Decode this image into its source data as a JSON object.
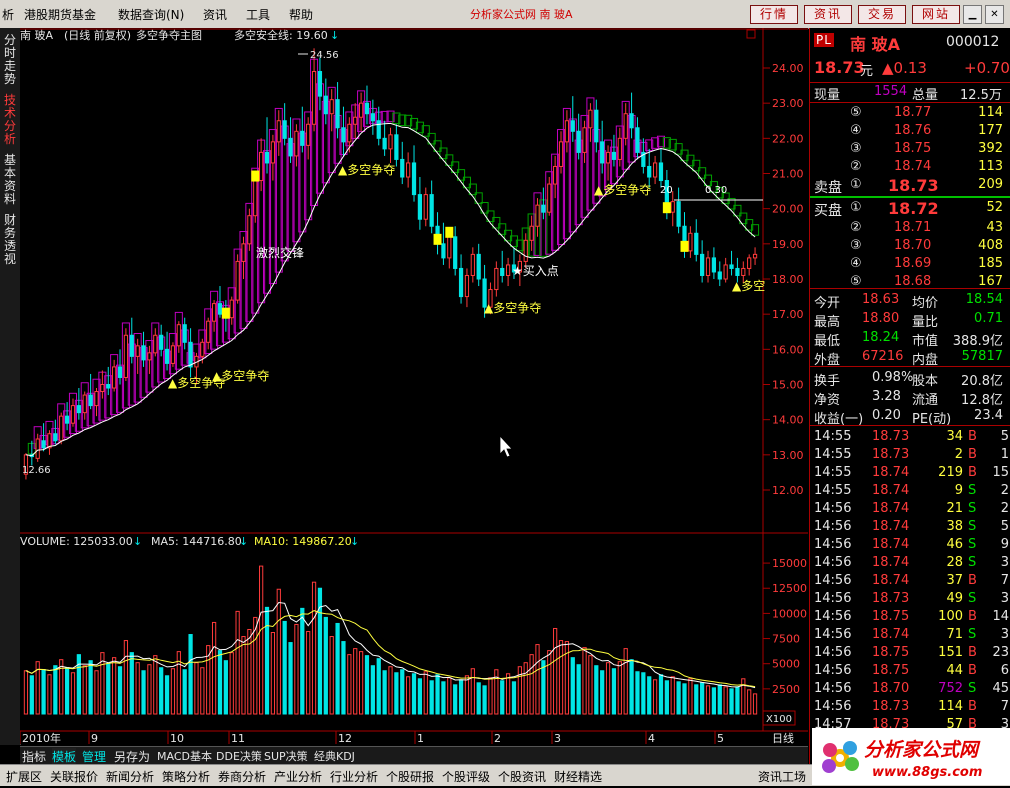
{
  "menu": {
    "items": [
      "析",
      "港股期货基金",
      "数据查询(N)",
      "资讯",
      "工具",
      "帮助"
    ],
    "center_title": "分析家公式网  南  玻A",
    "buttons": [
      "行情",
      "资讯",
      "交易",
      "网站"
    ]
  },
  "vtabs": [
    "分时走势",
    "技术分析",
    "基本资料",
    "财务透视"
  ],
  "chart": {
    "header_name": "南  玻A",
    "header_mode": "(日线 前复权)",
    "header_formula": "多空争夺主图",
    "safety_line_label": "多空安全线: 19.60",
    "max_label": "24.56",
    "min_label": "12.66",
    "y_ticks": [
      "24.00",
      "23.00",
      "22.00",
      "21.00",
      "20.00",
      "19.00",
      "18.00",
      "17.00",
      "16.00",
      "15.00",
      "14.00",
      "13.00",
      "12.00"
    ],
    "annotations": {
      "a1": "▲多空争夺",
      "a2": "▲多空争夺",
      "a3": "▲多空争夺",
      "a4": "▲多空争夺",
      "a5": "▲多空争夺",
      "a6": "▲多空",
      "buy": "★买入点",
      "cross": "激烈交锋",
      "v030": "0.30",
      "v020": "20"
    },
    "volume_label": "VOLUME: 125033.00",
    "ma5_label": "MA5: 144716.80",
    "ma10_label": "MA10: 149867.20",
    "vol_ticks": [
      "15000",
      "12500",
      "10000",
      "7500",
      "5000",
      "2500"
    ],
    "vol_unit": "X100",
    "x_axis": [
      "2010年",
      "9",
      "10",
      "11",
      "12",
      "1",
      "2",
      "3",
      "4",
      "5"
    ],
    "period": "日线",
    "colors": {
      "up": "#ff3b3b",
      "down": "#00e5e5",
      "ma": "#ffffff",
      "band_up": "#c000c0",
      "band_down": "#00a000",
      "marker": "#ffff00"
    },
    "candles": [
      [
        12.45,
        13.05,
        12.3,
        13.0
      ],
      [
        13.0,
        13.4,
        12.7,
        12.95
      ],
      [
        12.9,
        13.6,
        12.8,
        13.45
      ],
      [
        13.4,
        13.9,
        13.1,
        13.2
      ],
      [
        13.2,
        13.7,
        13.0,
        13.6
      ],
      [
        13.6,
        14.0,
        13.3,
        13.4
      ],
      [
        13.4,
        14.2,
        13.3,
        14.1
      ],
      [
        14.1,
        14.5,
        13.7,
        13.9
      ],
      [
        13.9,
        14.6,
        13.8,
        14.4
      ],
      [
        14.4,
        14.9,
        14.0,
        14.2
      ],
      [
        14.2,
        14.8,
        14.0,
        14.7
      ],
      [
        14.7,
        15.3,
        14.3,
        14.4
      ],
      [
        14.4,
        14.9,
        14.1,
        14.8
      ],
      [
        14.8,
        15.4,
        14.6,
        15.0
      ],
      [
        15.0,
        15.5,
        14.7,
        14.9
      ],
      [
        14.9,
        15.7,
        14.8,
        15.5
      ],
      [
        15.5,
        16.0,
        15.0,
        15.2
      ],
      [
        15.2,
        16.6,
        15.1,
        16.4
      ],
      [
        16.4,
        16.9,
        15.6,
        15.8
      ],
      [
        15.8,
        16.3,
        15.3,
        16.1
      ],
      [
        16.1,
        16.5,
        15.5,
        15.7
      ],
      [
        15.7,
        16.1,
        15.3,
        15.9
      ],
      [
        15.9,
        16.6,
        15.8,
        16.4
      ],
      [
        16.4,
        16.7,
        15.8,
        16.0
      ],
      [
        16.0,
        16.5,
        15.4,
        15.6
      ],
      [
        15.6,
        16.2,
        15.5,
        16.1
      ],
      [
        16.1,
        16.8,
        15.9,
        16.7
      ],
      [
        16.7,
        16.9,
        16.0,
        16.2
      ],
      [
        16.2,
        16.6,
        15.2,
        15.5
      ],
      [
        15.5,
        15.9,
        15.0,
        15.8
      ],
      [
        15.8,
        16.3,
        15.6,
        16.2
      ],
      [
        16.2,
        16.9,
        16.0,
        16.8
      ],
      [
        16.8,
        17.4,
        16.5,
        17.3
      ],
      [
        17.3,
        17.8,
        16.9,
        17.0
      ],
      [
        17.0,
        17.4,
        16.5,
        16.9
      ],
      [
        16.9,
        17.5,
        16.7,
        17.4
      ],
      [
        17.4,
        18.7,
        17.3,
        18.5
      ],
      [
        18.5,
        19.2,
        18.0,
        19.0
      ],
      [
        19.0,
        20.0,
        18.8,
        19.8
      ],
      [
        19.8,
        21.0,
        19.6,
        20.8
      ],
      [
        20.8,
        22.0,
        20.5,
        21.6
      ],
      [
        21.6,
        22.6,
        21.0,
        21.3
      ],
      [
        21.3,
        22.1,
        20.8,
        21.9
      ],
      [
        21.9,
        22.8,
        21.5,
        22.5
      ],
      [
        22.5,
        23.0,
        21.8,
        22.0
      ],
      [
        22.0,
        22.6,
        21.3,
        21.5
      ],
      [
        21.5,
        22.4,
        21.2,
        22.2
      ],
      [
        22.2,
        22.9,
        21.6,
        21.8
      ],
      [
        21.8,
        22.6,
        21.4,
        22.4
      ],
      [
        22.4,
        24.56,
        22.2,
        23.9
      ],
      [
        23.9,
        24.3,
        22.8,
        23.2
      ],
      [
        23.2,
        23.7,
        22.4,
        22.7
      ],
      [
        22.7,
        23.4,
        22.2,
        23.1
      ],
      [
        23.1,
        23.6,
        22.0,
        22.3
      ],
      [
        22.3,
        22.9,
        21.5,
        21.9
      ],
      [
        21.9,
        22.6,
        21.6,
        22.4
      ],
      [
        22.4,
        23.0,
        22.0,
        22.6
      ],
      [
        22.6,
        23.3,
        22.2,
        23.0
      ],
      [
        23.0,
        23.5,
        22.4,
        22.7
      ],
      [
        22.7,
        23.1,
        22.1,
        22.5
      ],
      [
        22.5,
        22.9,
        21.8,
        22.0
      ],
      [
        22.0,
        22.5,
        21.5,
        21.7
      ],
      [
        21.7,
        22.3,
        21.3,
        22.1
      ],
      [
        22.1,
        22.4,
        21.2,
        21.4
      ],
      [
        21.4,
        21.9,
        20.7,
        20.9
      ],
      [
        20.9,
        21.6,
        20.6,
        21.3
      ],
      [
        21.3,
        21.8,
        20.2,
        20.4
      ],
      [
        20.4,
        20.9,
        19.4,
        19.7
      ],
      [
        19.7,
        20.6,
        19.5,
        20.4
      ],
      [
        20.4,
        20.8,
        19.3,
        19.5
      ],
      [
        19.5,
        19.9,
        18.7,
        19.0
      ],
      [
        19.0,
        19.6,
        18.4,
        18.6
      ],
      [
        18.6,
        19.4,
        18.3,
        19.2
      ],
      [
        19.2,
        19.5,
        18.1,
        18.3
      ],
      [
        18.3,
        18.7,
        17.3,
        17.5
      ],
      [
        17.5,
        18.3,
        17.2,
        18.1
      ],
      [
        18.1,
        18.9,
        17.9,
        18.7
      ],
      [
        18.7,
        19.0,
        17.8,
        18.0
      ],
      [
        18.0,
        18.4,
        16.9,
        17.2
      ],
      [
        17.2,
        17.9,
        17.0,
        17.7
      ],
      [
        17.7,
        18.5,
        17.5,
        18.3
      ],
      [
        18.3,
        18.8,
        17.9,
        18.1
      ],
      [
        18.1,
        18.6,
        17.8,
        18.4
      ],
      [
        18.4,
        18.9,
        18.0,
        18.2
      ],
      [
        18.2,
        18.7,
        17.8,
        18.5
      ],
      [
        18.5,
        19.3,
        18.3,
        19.1
      ],
      [
        19.1,
        19.8,
        18.8,
        19.5
      ],
      [
        19.5,
        20.3,
        19.2,
        20.1
      ],
      [
        20.1,
        20.6,
        19.7,
        19.9
      ],
      [
        19.9,
        20.9,
        19.8,
        20.7
      ],
      [
        20.7,
        21.5,
        20.3,
        21.2
      ],
      [
        21.2,
        22.2,
        21.0,
        21.9
      ],
      [
        21.9,
        22.8,
        21.6,
        22.5
      ],
      [
        22.5,
        23.2,
        21.9,
        22.2
      ],
      [
        22.2,
        22.7,
        21.4,
        21.6
      ],
      [
        21.6,
        22.5,
        21.3,
        22.3
      ],
      [
        22.3,
        23.0,
        21.9,
        22.8
      ],
      [
        22.8,
        23.1,
        21.6,
        21.9
      ],
      [
        21.9,
        22.5,
        21.0,
        21.3
      ],
      [
        21.3,
        21.8,
        20.8,
        21.6
      ],
      [
        21.6,
        22.1,
        21.2,
        21.4
      ],
      [
        21.4,
        22.3,
        21.2,
        22.0
      ],
      [
        22.0,
        23.0,
        21.8,
        22.7
      ],
      [
        22.7,
        23.3,
        22.0,
        22.3
      ],
      [
        22.3,
        22.6,
        21.4,
        21.6
      ],
      [
        21.6,
        22.0,
        21.0,
        21.2
      ],
      [
        21.2,
        21.7,
        20.6,
        20.9
      ],
      [
        20.9,
        21.5,
        20.7,
        21.3
      ],
      [
        21.3,
        21.7,
        20.6,
        20.8
      ],
      [
        20.8,
        21.1,
        19.7,
        19.9
      ],
      [
        19.9,
        20.5,
        19.5,
        20.2
      ],
      [
        20.2,
        20.6,
        19.3,
        19.5
      ],
      [
        19.5,
        19.9,
        18.6,
        18.8
      ],
      [
        18.8,
        19.5,
        18.6,
        19.3
      ],
      [
        19.3,
        19.7,
        18.5,
        18.7
      ],
      [
        18.7,
        19.1,
        17.9,
        18.1
      ],
      [
        18.1,
        18.8,
        17.9,
        18.6
      ],
      [
        18.6,
        18.9,
        18.0,
        18.2
      ],
      [
        18.2,
        18.5,
        17.8,
        18.0
      ],
      [
        18.0,
        18.6,
        17.9,
        18.4
      ],
      [
        18.4,
        18.8,
        18.1,
        18.3
      ],
      [
        18.3,
        18.6,
        17.9,
        18.1
      ],
      [
        18.1,
        18.5,
        17.9,
        18.3
      ],
      [
        18.3,
        18.7,
        18.1,
        18.6
      ],
      [
        18.6,
        18.9,
        18.4,
        18.7
      ]
    ],
    "volumes": [
      4300,
      3800,
      5200,
      4400,
      3900,
      4800,
      5400,
      4600,
      4100,
      5900,
      4800,
      5300,
      4300,
      6100,
      5000,
      5600,
      4700,
      7300,
      6100,
      5100,
      4300,
      4900,
      5800,
      4600,
      3800,
      4500,
      6200,
      4400,
      7900,
      5100,
      4600,
      6800,
      9100,
      6300,
      5300,
      6100,
      10200,
      7700,
      8400,
      9600,
      14700,
      10600,
      8100,
      12400,
      9200,
      7100,
      8900,
      10500,
      8200,
      13100,
      12500,
      9600,
      7700,
      9000,
      7200,
      5900,
      6500,
      6200,
      5800,
      4800,
      5500,
      4300,
      4700,
      4100,
      4400,
      3700,
      4000,
      3500,
      4200,
      3300,
      3900,
      3200,
      3600,
      2900,
      3400,
      3800,
      4500,
      3100,
      2800,
      3600,
      4400,
      3300,
      4000,
      3200,
      4700,
      5100,
      5900,
      6900,
      5300,
      6300,
      8500,
      7300,
      7200,
      5600,
      4900,
      6600,
      5800,
      4800,
      4300,
      5100,
      4500,
      5200,
      6500,
      5400,
      4200,
      4100,
      3700,
      3400,
      3900,
      3300,
      3700,
      3200,
      3000,
      3500,
      2900,
      3100,
      2800,
      2600,
      2900,
      2700,
      2500,
      2700,
      3500,
      2400,
      2000
    ]
  },
  "panel": {
    "badge": "PL",
    "name": "南  玻A",
    "code": "000012",
    "price": "18.73",
    "price_unit": "元",
    "change": "▲0.13",
    "change_pct": "+0.70",
    "now_vol_label": "现量",
    "now_vol": "1554",
    "total_vol_label": "总量",
    "total_vol": "12.5万",
    "asks": [
      {
        "lvl": "⑤",
        "price": "18.77",
        "vol": "114"
      },
      {
        "lvl": "④",
        "price": "18.76",
        "vol": "177"
      },
      {
        "lvl": "③",
        "price": "18.75",
        "vol": "392"
      },
      {
        "lvl": "②",
        "price": "18.74",
        "vol": "113"
      }
    ],
    "ask1_label": "卖盘",
    "ask1_lvl": "①",
    "ask1_price": "18.73",
    "ask1_vol": "209",
    "bid1_label": "买盘",
    "bid1_lvl": "①",
    "bid1_price": "18.72",
    "bid1_vol": "52",
    "bids": [
      {
        "lvl": "②",
        "price": "18.71",
        "vol": "43"
      },
      {
        "lvl": "③",
        "price": "18.70",
        "vol": "408"
      },
      {
        "lvl": "④",
        "price": "18.69",
        "vol": "185"
      },
      {
        "lvl": "⑤",
        "price": "18.68",
        "vol": "167"
      }
    ],
    "stats": [
      {
        "l1": "今开",
        "v1": "18.63",
        "c1": "red",
        "l2": "均价",
        "v2": "18.54",
        "c2": "green"
      },
      {
        "l1": "最高",
        "v1": "18.80",
        "c1": "red",
        "l2": "量比",
        "v2": "0.71",
        "c2": "green"
      },
      {
        "l1": "最低",
        "v1": "18.24",
        "c1": "green",
        "l2": "市值",
        "v2": "388.9亿",
        "c2": "white"
      },
      {
        "l1": "外盘",
        "v1": "67216",
        "c1": "red",
        "l2": "内盘",
        "v2": "57817",
        "c2": "green"
      }
    ],
    "fin": [
      {
        "l1": "换手",
        "v1": "0.98%",
        "l2": "股本",
        "v2": "20.8亿"
      },
      {
        "l1": "净资",
        "v1": "3.28",
        "l2": "流通",
        "v2": "12.8亿"
      },
      {
        "l1": "收益(一)",
        "v1": "0.20",
        "l2": "PE(动)",
        "v2": "23.4"
      }
    ],
    "ticks": [
      {
        "t": "14:55",
        "p": "18.73",
        "v": "34",
        "s": "B",
        "n": "5"
      },
      {
        "t": "14:55",
        "p": "18.73",
        "v": "2",
        "s": "B",
        "n": "1"
      },
      {
        "t": "14:55",
        "p": "18.74",
        "v": "219",
        "s": "B",
        "n": "15"
      },
      {
        "t": "14:55",
        "p": "18.74",
        "v": "9",
        "s": "S",
        "n": "2"
      },
      {
        "t": "14:56",
        "p": "18.74",
        "v": "21",
        "s": "S",
        "n": "2"
      },
      {
        "t": "14:56",
        "p": "18.74",
        "v": "38",
        "s": "S",
        "n": "5"
      },
      {
        "t": "14:56",
        "p": "18.74",
        "v": "46",
        "s": "S",
        "n": "9"
      },
      {
        "t": "14:56",
        "p": "18.74",
        "v": "28",
        "s": "S",
        "n": "3"
      },
      {
        "t": "14:56",
        "p": "18.74",
        "v": "37",
        "s": "B",
        "n": "7"
      },
      {
        "t": "14:56",
        "p": "18.73",
        "v": "49",
        "s": "S",
        "n": "3"
      },
      {
        "t": "14:56",
        "p": "18.75",
        "v": "100",
        "s": "B",
        "n": "14"
      },
      {
        "t": "14:56",
        "p": "18.74",
        "v": "71",
        "s": "S",
        "n": "3"
      },
      {
        "t": "14:56",
        "p": "18.75",
        "v": "151",
        "s": "B",
        "n": "23"
      },
      {
        "t": "14:56",
        "p": "18.75",
        "v": "44",
        "s": "B",
        "n": "6"
      },
      {
        "t": "14:56",
        "p": "18.70",
        "v": "752",
        "s": "S",
        "n": "45"
      },
      {
        "t": "14:56",
        "p": "18.73",
        "v": "114",
        "s": "B",
        "n": "7"
      },
      {
        "t": "14:57",
        "p": "18.73",
        "v": "57",
        "s": "B",
        "n": "3"
      }
    ]
  },
  "bottom_tabs": [
    "指标",
    "模板",
    "管理",
    "另存为",
    "MACD基本",
    "DDE决策",
    "SUP决策",
    "经典KDJ"
  ],
  "bottom_bar": [
    "扩展区",
    "关联报价",
    "新闻分析",
    "策略分析",
    "券商分析",
    "产业分析",
    "行业分析",
    "个股研报",
    "个股评级",
    "个股资讯",
    "财经精选"
  ],
  "bottom_right": "资讯工场",
  "logo": {
    "text": "分析家公式网",
    "url": "www.88gs.com"
  }
}
